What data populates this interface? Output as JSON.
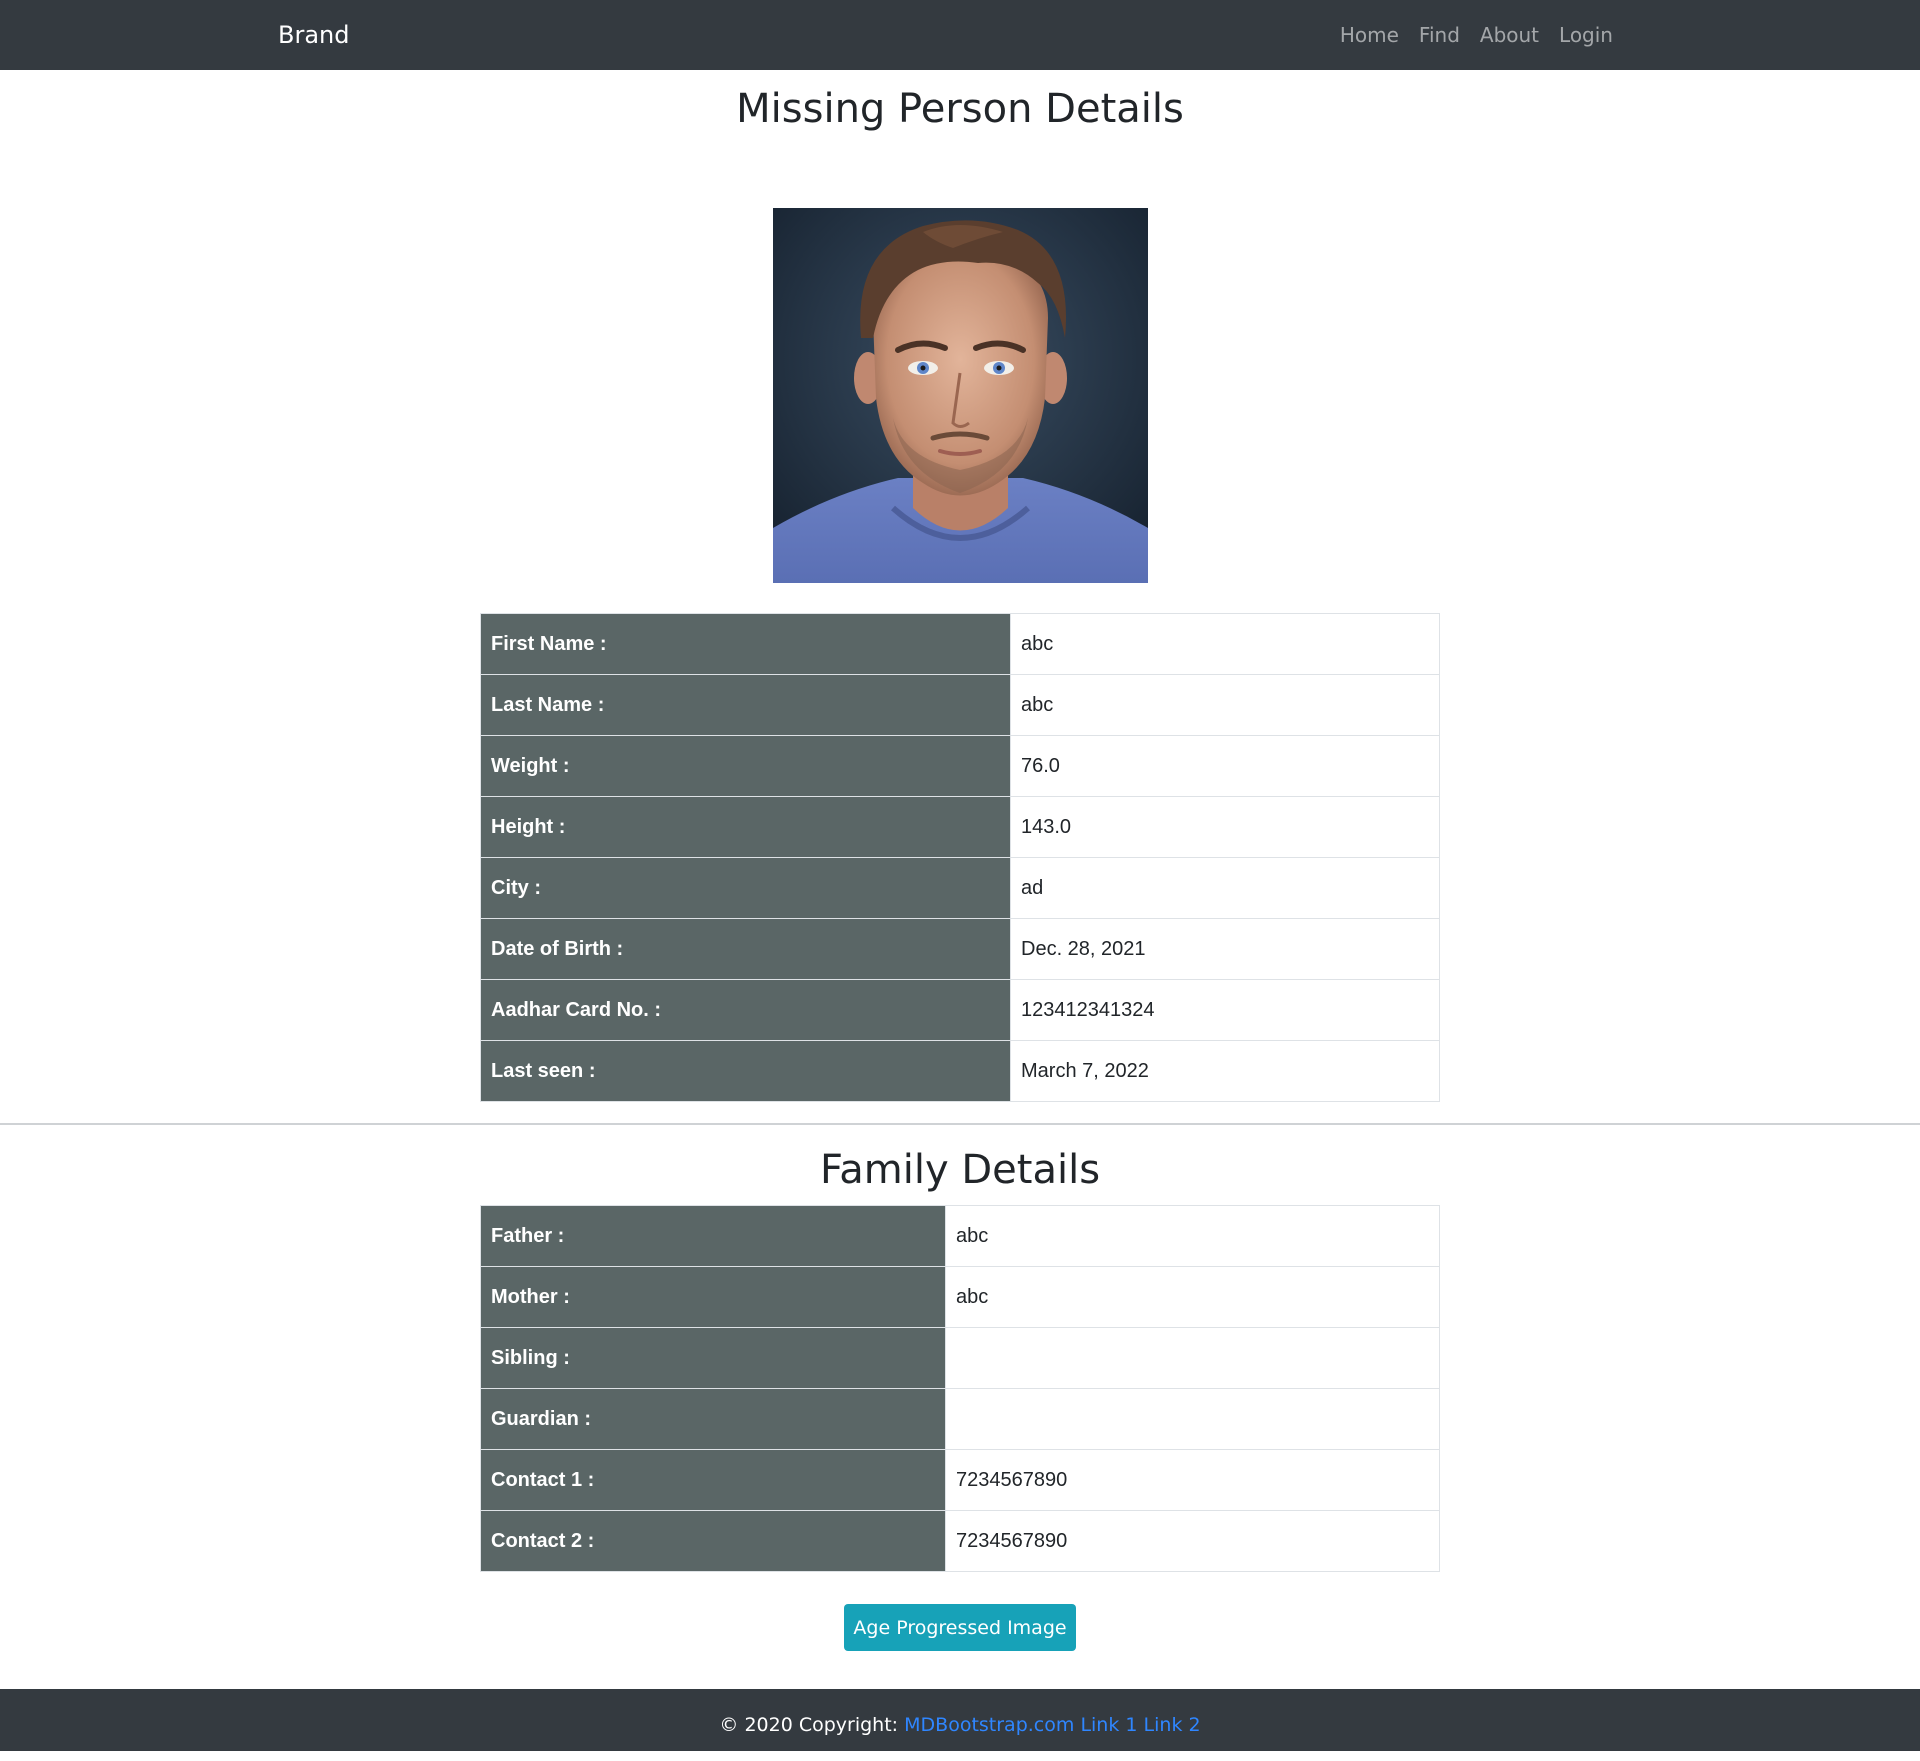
{
  "navbar": {
    "brand": "Brand",
    "links": [
      "Home",
      "Find",
      "About",
      "Login"
    ]
  },
  "page_title": "Missing Person Details",
  "photo": {
    "icon": "person-portrait-photo"
  },
  "person_details": [
    {
      "label": "First Name :",
      "value": "abc"
    },
    {
      "label": "Last Name :",
      "value": "abc"
    },
    {
      "label": "Weight :",
      "value": "76.0"
    },
    {
      "label": "Height :",
      "value": "143.0"
    },
    {
      "label": "City :",
      "value": "ad"
    },
    {
      "label": "Date of Birth :",
      "value": "Dec. 28, 2021"
    },
    {
      "label": "Aadhar Card No. :",
      "value": "123412341324"
    },
    {
      "label": "Last seen :",
      "value": "March 7, 2022"
    }
  ],
  "family_title": "Family Details",
  "family_details": [
    {
      "label": "Father :",
      "value": "abc"
    },
    {
      "label": "Mother :",
      "value": "abc"
    },
    {
      "label": "Sibling :",
      "value": ""
    },
    {
      "label": "Guardian :",
      "value": ""
    },
    {
      "label": "Contact 1 :",
      "value": "7234567890"
    },
    {
      "label": "Contact 2 :",
      "value": "7234567890"
    }
  ],
  "age_button_label": "Age Progressed Image",
  "footer": {
    "copyright": "© 2020 Copyright:",
    "links": [
      "MDBootstrap.com",
      "Link 1",
      "Link 2"
    ]
  },
  "colors": {
    "navbar_bg": "#343a40",
    "label_cell_bg": "#5a6666",
    "button_bg": "#17a2b8",
    "footer_link": "#2f86ff"
  }
}
